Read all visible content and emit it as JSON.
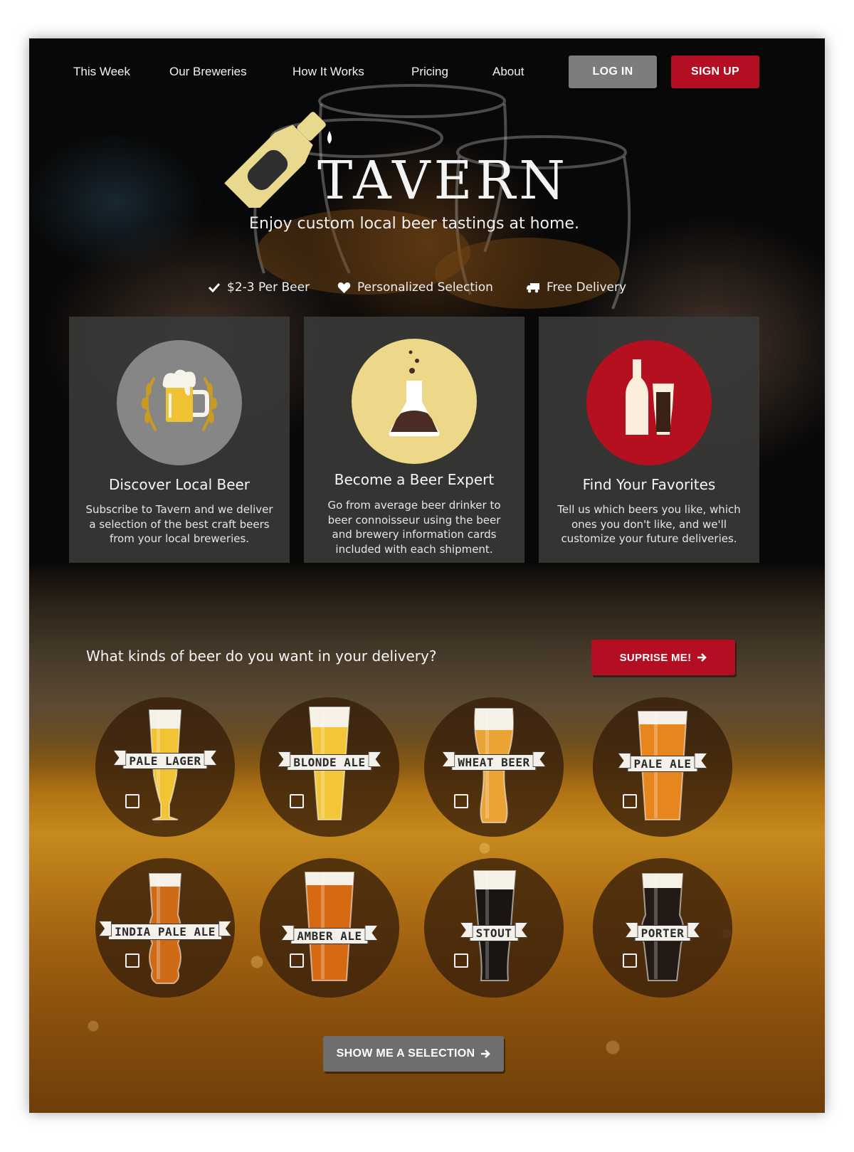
{
  "nav": {
    "links": [
      "This Week",
      "Our Breweries",
      "How It Works",
      "Pricing",
      "About"
    ],
    "login_label": "LOG IN",
    "signup_label": "SIGN UP"
  },
  "hero": {
    "brand": "TAVERN",
    "tagline": "Enjoy custom local beer tastings at home.",
    "features": [
      {
        "icon": "check-icon",
        "label": "$2-3 Per Beer"
      },
      {
        "icon": "heart-icon",
        "label": "Personalized Selection"
      },
      {
        "icon": "truck-icon",
        "label": "Free Delivery"
      }
    ]
  },
  "cards": [
    {
      "icon": "beer-mug-laurel-icon",
      "title": "Discover Local Beer",
      "text": "Subscribe to Tavern and we deliver a selection of the best craft beers from your local breweries."
    },
    {
      "icon": "flask-icon",
      "title": "Become a Beer Expert",
      "text": "Go from average beer drinker to beer connoisseur using the beer and brewery information cards included with each shipment."
    },
    {
      "icon": "bottle-and-glass-icon",
      "title": "Find Your Favorites",
      "text": "Tell us which beers you like, which ones you don't like, and we'll customize your future deliveries."
    }
  ],
  "selection": {
    "question": "What kinds of beer do you want in your delivery?",
    "surprise_label": "SUPRISE ME!",
    "beers": [
      {
        "label": "PALE LAGER",
        "color": "#f2c334",
        "checked": false
      },
      {
        "label": "BLONDE ALE",
        "color": "#f3c63a",
        "checked": false
      },
      {
        "label": "WHEAT BEER",
        "color": "#eaa335",
        "checked": false
      },
      {
        "label": "PALE ALE",
        "color": "#e8861e",
        "checked": false
      },
      {
        "label": "INDIA PALE ALE",
        "color": "#cf6a16",
        "checked": false
      },
      {
        "label": "AMBER ALE",
        "color": "#d66a12",
        "checked": false
      },
      {
        "label": "STOUT",
        "color": "#1a1412",
        "checked": false
      },
      {
        "label": "PORTER",
        "color": "#241a15",
        "checked": false
      }
    ],
    "show_label": "SHOW ME A SELECTION"
  },
  "colors": {
    "accent_red": "#b30e21",
    "button_gray": "#7d7d7d",
    "icon_gray": "#868686",
    "icon_yellow": "#ecd888",
    "icon_red": "#b4101f"
  }
}
